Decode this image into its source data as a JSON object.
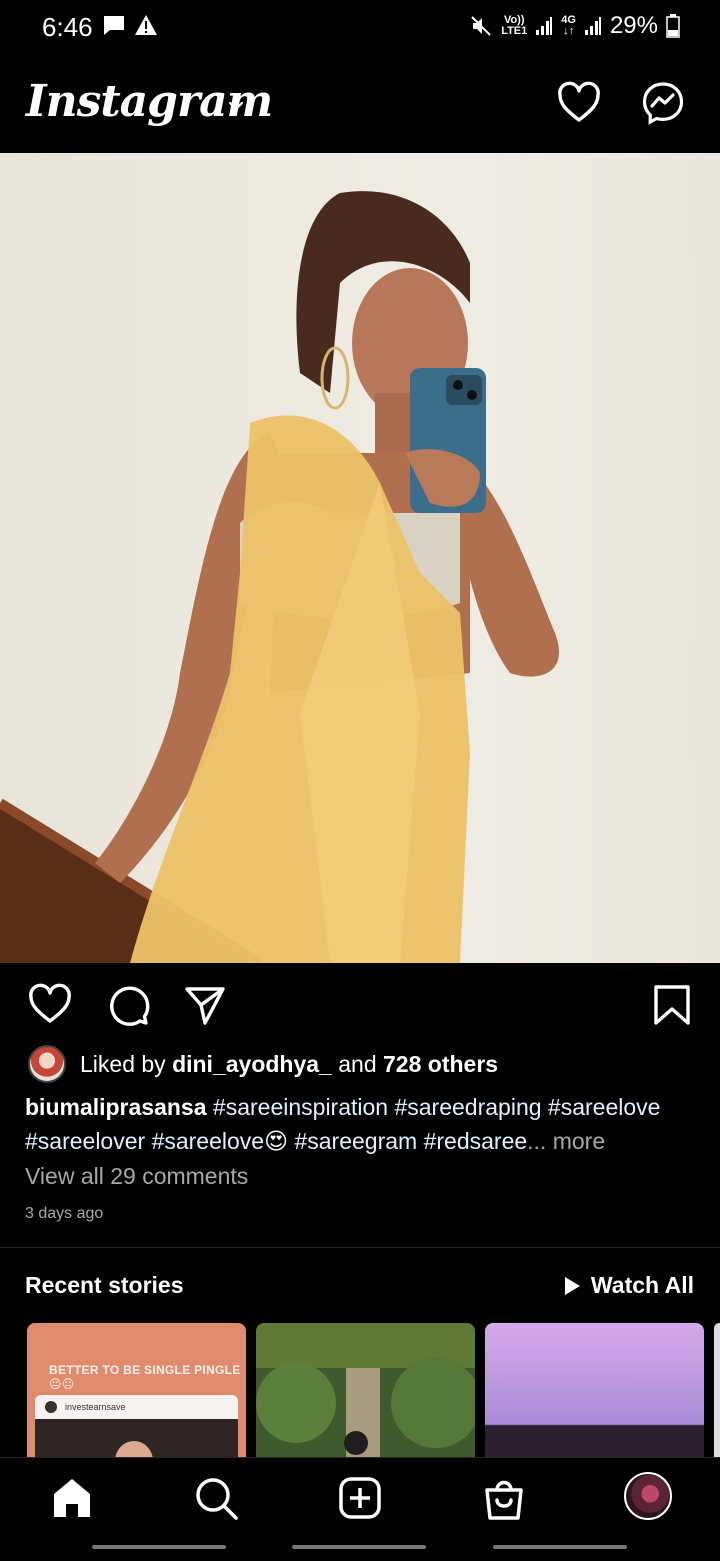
{
  "status_bar": {
    "time": "6:46",
    "network_top": "Vo))",
    "network_bottom": "LTE1",
    "network2_top": "4G",
    "network2_bottom": "↓↑",
    "battery": "29%"
  },
  "header": {
    "logo": "Instagram"
  },
  "post": {
    "liked_by_prefix": "Liked by ",
    "liked_by_user": "dini_ayodhya_",
    "liked_by_and": " and ",
    "liked_by_others": "728 others",
    "username": "biumaliprasansa",
    "caption_line1": " #sareeinspiration #sareedraping #sareelove",
    "caption_line2a": "#sareelover #sareelove",
    "caption_emoji": "😍",
    "caption_line2b": " #sareegram #redsaree",
    "ellipsis": "...",
    "more": " more",
    "view_comments": "View all 29 comments",
    "time_ago": "3 days ago"
  },
  "recent_stories": {
    "title": "Recent stories",
    "watch_all": "Watch All",
    "story1_text": "BETTER TO BE SINGLE PINGLE 😐😐",
    "story1_handle": "investearnsave"
  }
}
